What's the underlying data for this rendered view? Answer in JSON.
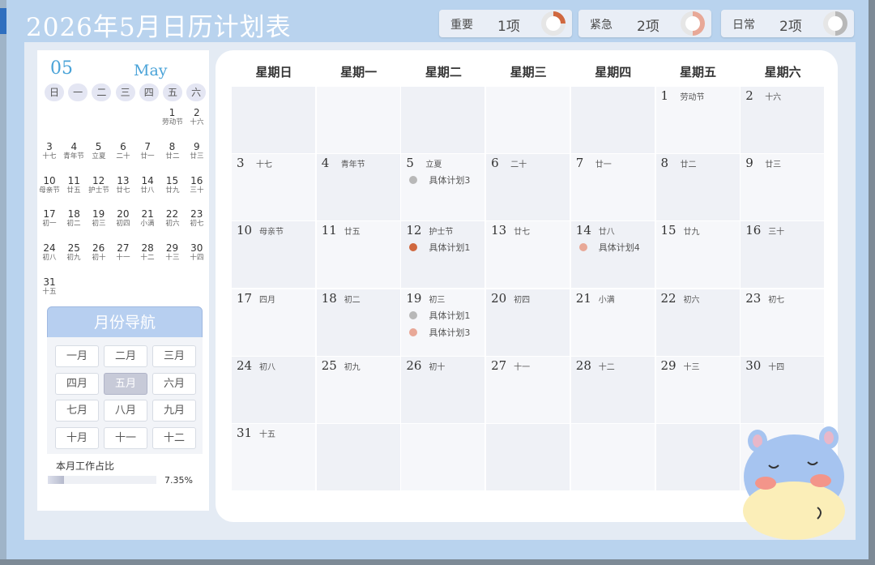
{
  "title": "2026年5月日历计划表",
  "stats": [
    {
      "label": "重要",
      "count": "1项",
      "progress": 0.25,
      "color": "#d0683f"
    },
    {
      "label": "紧急",
      "count": "2项",
      "progress": 0.5,
      "color": "#e8a897"
    },
    {
      "label": "日常",
      "count": "2项",
      "progress": 0.5,
      "color": "#b8b8b8"
    }
  ],
  "mini": {
    "month_num": "05",
    "month_name": "May",
    "weekdays": [
      "日",
      "一",
      "二",
      "三",
      "四",
      "五",
      "六"
    ],
    "days": [
      {
        "d": "1",
        "l": "劳动节"
      },
      {
        "d": "2",
        "l": "十六"
      },
      {
        "d": "3",
        "l": "十七"
      },
      {
        "d": "4",
        "l": "青年节"
      },
      {
        "d": "5",
        "l": "立夏"
      },
      {
        "d": "6",
        "l": "二十"
      },
      {
        "d": "7",
        "l": "廿一"
      },
      {
        "d": "8",
        "l": "廿二"
      },
      {
        "d": "9",
        "l": "廿三"
      },
      {
        "d": "10",
        "l": "母亲节"
      },
      {
        "d": "11",
        "l": "廿五"
      },
      {
        "d": "12",
        "l": "护士节"
      },
      {
        "d": "13",
        "l": "廿七"
      },
      {
        "d": "14",
        "l": "廿八"
      },
      {
        "d": "15",
        "l": "廿九"
      },
      {
        "d": "16",
        "l": "三十"
      },
      {
        "d": "17",
        "l": "初一"
      },
      {
        "d": "18",
        "l": "初二"
      },
      {
        "d": "19",
        "l": "初三"
      },
      {
        "d": "20",
        "l": "初四"
      },
      {
        "d": "21",
        "l": "小满"
      },
      {
        "d": "22",
        "l": "初六"
      },
      {
        "d": "23",
        "l": "初七"
      },
      {
        "d": "24",
        "l": "初八"
      },
      {
        "d": "25",
        "l": "初九"
      },
      {
        "d": "26",
        "l": "初十"
      },
      {
        "d": "27",
        "l": "十一"
      },
      {
        "d": "28",
        "l": "十二"
      },
      {
        "d": "29",
        "l": "十三"
      },
      {
        "d": "30",
        "l": "十四"
      },
      {
        "d": "31",
        "l": "十五"
      }
    ]
  },
  "nav": {
    "header": "月份导航",
    "months": [
      "一月",
      "二月",
      "三月",
      "四月",
      "五月",
      "六月",
      "七月",
      "八月",
      "九月",
      "十月",
      "十一",
      "十二"
    ],
    "active_index": 4
  },
  "work": {
    "label": "本月工作占比",
    "percent": "7.35%",
    "fraction": 0.0735
  },
  "calendar": {
    "weekdays": [
      "星期日",
      "星期一",
      "星期二",
      "星期三",
      "星期四",
      "星期五",
      "星期六"
    ],
    "days": [
      {
        "d": "1",
        "l": "劳动节"
      },
      {
        "d": "2",
        "l": "十六"
      },
      {
        "d": "3",
        "l": "十七"
      },
      {
        "d": "4",
        "l": "青年节"
      },
      {
        "d": "5",
        "l": "立夏"
      },
      {
        "d": "6",
        "l": "二十"
      },
      {
        "d": "7",
        "l": "廿一"
      },
      {
        "d": "8",
        "l": "廿二"
      },
      {
        "d": "9",
        "l": "廿三"
      },
      {
        "d": "10",
        "l": "母亲节"
      },
      {
        "d": "11",
        "l": "廿五"
      },
      {
        "d": "12",
        "l": "护士节"
      },
      {
        "d": "13",
        "l": "廿七"
      },
      {
        "d": "14",
        "l": "廿八"
      },
      {
        "d": "15",
        "l": "廿九"
      },
      {
        "d": "16",
        "l": "三十"
      },
      {
        "d": "17",
        "l": "四月"
      },
      {
        "d": "18",
        "l": "初二"
      },
      {
        "d": "19",
        "l": "初三"
      },
      {
        "d": "20",
        "l": "初四"
      },
      {
        "d": "21",
        "l": "小满"
      },
      {
        "d": "22",
        "l": "初六"
      },
      {
        "d": "23",
        "l": "初七"
      },
      {
        "d": "24",
        "l": "初八"
      },
      {
        "d": "25",
        "l": "初九"
      },
      {
        "d": "26",
        "l": "初十"
      },
      {
        "d": "27",
        "l": "十一"
      },
      {
        "d": "28",
        "l": "十二"
      },
      {
        "d": "29",
        "l": "十三"
      },
      {
        "d": "30",
        "l": "十四"
      },
      {
        "d": "31",
        "l": "十五"
      }
    ],
    "events": [
      {
        "day": "5",
        "items": [
          {
            "text": "具体计划3",
            "color": "#b8b8b8"
          }
        ]
      },
      {
        "day": "12",
        "items": [
          {
            "text": "具体计划1",
            "color": "#d0683f"
          }
        ]
      },
      {
        "day": "14",
        "items": [
          {
            "text": "具体计划4",
            "color": "#e8a897"
          }
        ]
      },
      {
        "day": "19",
        "items": [
          {
            "text": "具体计划1",
            "color": "#b8b8b8"
          },
          {
            "text": "具体计划3",
            "color": "#e8a897"
          }
        ]
      }
    ]
  }
}
